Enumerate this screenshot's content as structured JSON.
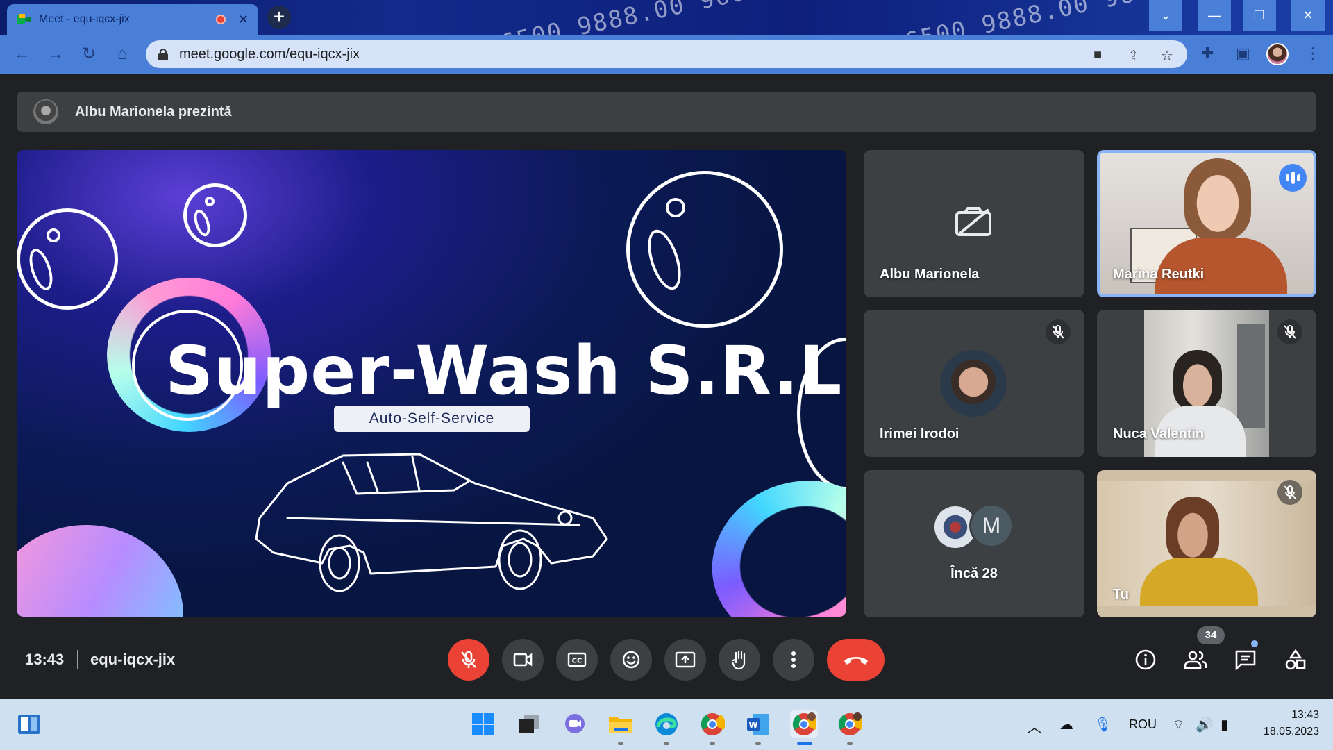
{
  "browser": {
    "tab_title": "Meet - equ-iqcx-jix",
    "url": "meet.google.com/equ-iqcx-jix"
  },
  "meet": {
    "presenting_text": "Albu Marionela prezintă",
    "slide": {
      "title": "Super-Wash S.R.L.",
      "subtitle": "Auto-Self-Service"
    },
    "tiles": [
      {
        "name": "Albu Marionela",
        "camera_off": true
      },
      {
        "name": "Marina Reutki",
        "speaking": true
      },
      {
        "name": "Irimei Irodoi",
        "muted": true
      },
      {
        "name": "Nuca Valentin",
        "muted": true
      },
      {
        "name": "Încă 28",
        "avatar_letter": "M"
      },
      {
        "name": "Tu",
        "muted": true
      }
    ],
    "time": "13:43",
    "meeting_code": "equ-iqcx-jix",
    "people_count": "34"
  },
  "taskbar": {
    "language": "ROU",
    "time": "13:43",
    "date": "18.05.2023"
  },
  "colors": {
    "meet_bg": "#202124",
    "tile_bg": "#3c4043",
    "danger": "#ea4335",
    "chrome_blue": "#4a7fd8",
    "speaking_blue": "#8ab4f8"
  }
}
